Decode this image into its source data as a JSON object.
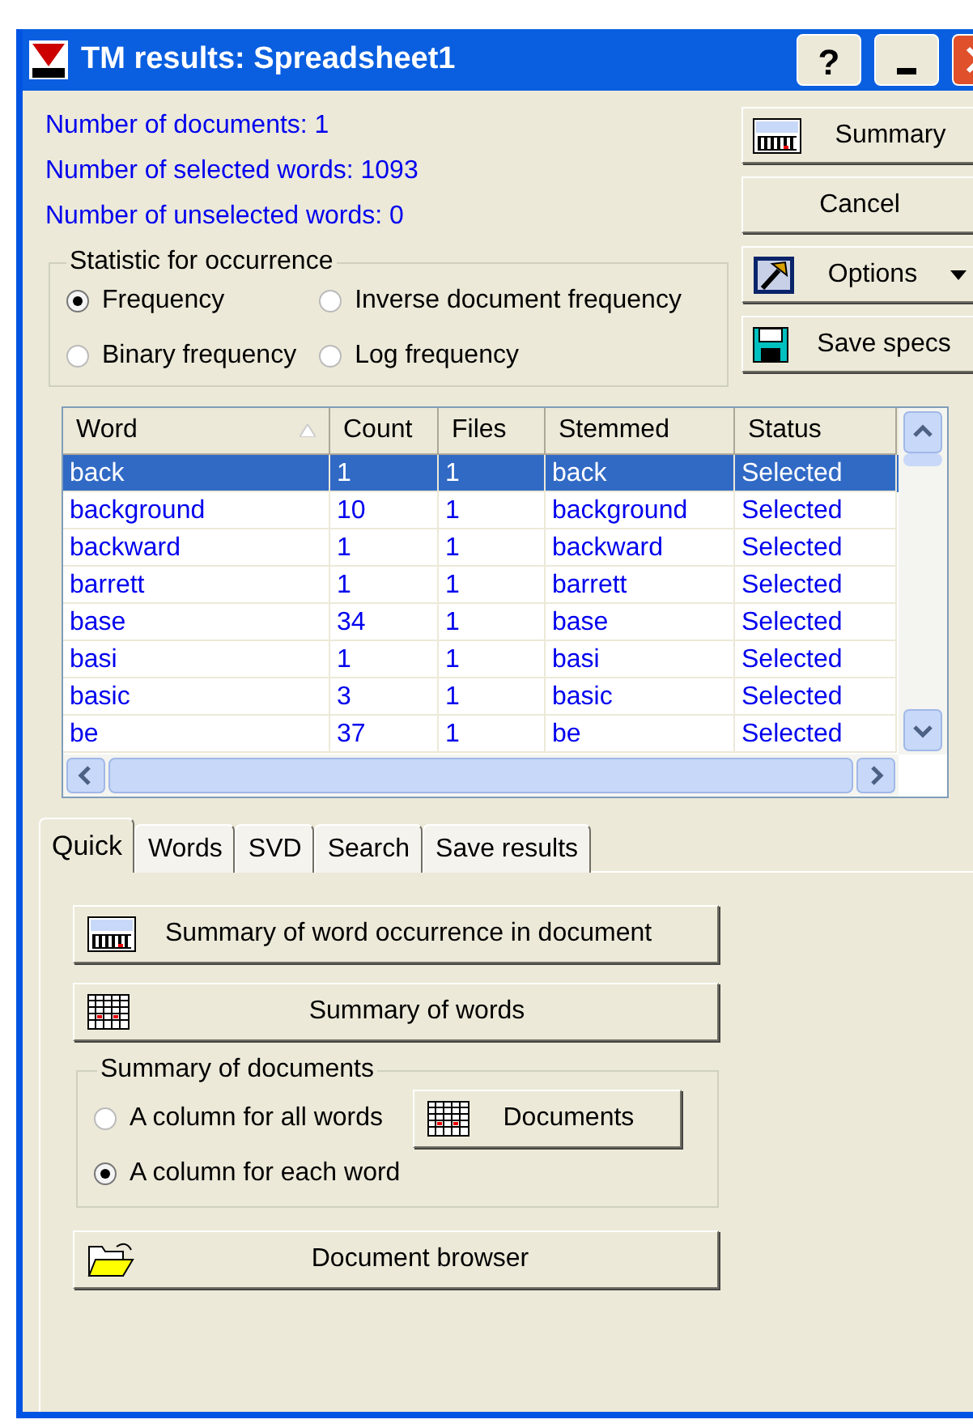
{
  "window": {
    "title": "TM results: Spreadsheet1",
    "title_buttons": [
      "?"
    ]
  },
  "info": [
    "Number of documents: 1",
    "Number of selected words: 1093",
    "Number of unselected words: 0"
  ],
  "side_buttons": [
    {
      "label": "Summary",
      "kind": "summary"
    },
    {
      "label": "Cancel",
      "kind": "plain"
    },
    {
      "label": "Options",
      "kind": "options"
    },
    {
      "label": "Save specs",
      "kind": "save"
    }
  ],
  "statistic": {
    "title": "Statistic for occurrence",
    "options": [
      {
        "label": "Frequency",
        "selected": true
      },
      {
        "label": "Inverse document frequency",
        "selected": false
      },
      {
        "label": "Binary frequency",
        "selected": false
      },
      {
        "label": "Log frequency",
        "selected": false
      }
    ]
  },
  "table": {
    "columns": [
      "Word",
      "Count",
      "Files",
      "Stemmed",
      "Status"
    ],
    "rows": [
      {
        "cells": [
          "back",
          "1",
          "1",
          "back",
          "Selected"
        ],
        "selected": true
      },
      {
        "cells": [
          "background",
          "10",
          "1",
          "background",
          "Selected"
        ],
        "selected": false
      },
      {
        "cells": [
          "backward",
          "1",
          "1",
          "backward",
          "Selected"
        ],
        "selected": false
      },
      {
        "cells": [
          "barrett",
          "1",
          "1",
          "barrett",
          "Selected"
        ],
        "selected": false
      },
      {
        "cells": [
          "base",
          "34",
          "1",
          "base",
          "Selected"
        ],
        "selected": false
      },
      {
        "cells": [
          "basi",
          "1",
          "1",
          "basi",
          "Selected"
        ],
        "selected": false
      },
      {
        "cells": [
          "basic",
          "3",
          "1",
          "basic",
          "Selected"
        ],
        "selected": false
      },
      {
        "cells": [
          "be",
          "37",
          "1",
          "be",
          "Selected"
        ],
        "selected": false
      }
    ]
  },
  "tabs": [
    {
      "label": "Quick",
      "selected": true
    },
    {
      "label": "Words",
      "selected": false
    },
    {
      "label": "SVD",
      "selected": false
    },
    {
      "label": "Search",
      "selected": false
    },
    {
      "label": "Save results",
      "selected": false
    }
  ],
  "quick": {
    "summary_button": "Summary of word occurrence in document",
    "words_button": "Summary of words",
    "documents_group": {
      "title": "Summary of documents",
      "options": [
        {
          "label": "A column for all words",
          "selected": false
        },
        {
          "label": "A column for each word",
          "selected": true
        }
      ],
      "button": "Documents"
    },
    "browser_button": "Document browser"
  }
}
